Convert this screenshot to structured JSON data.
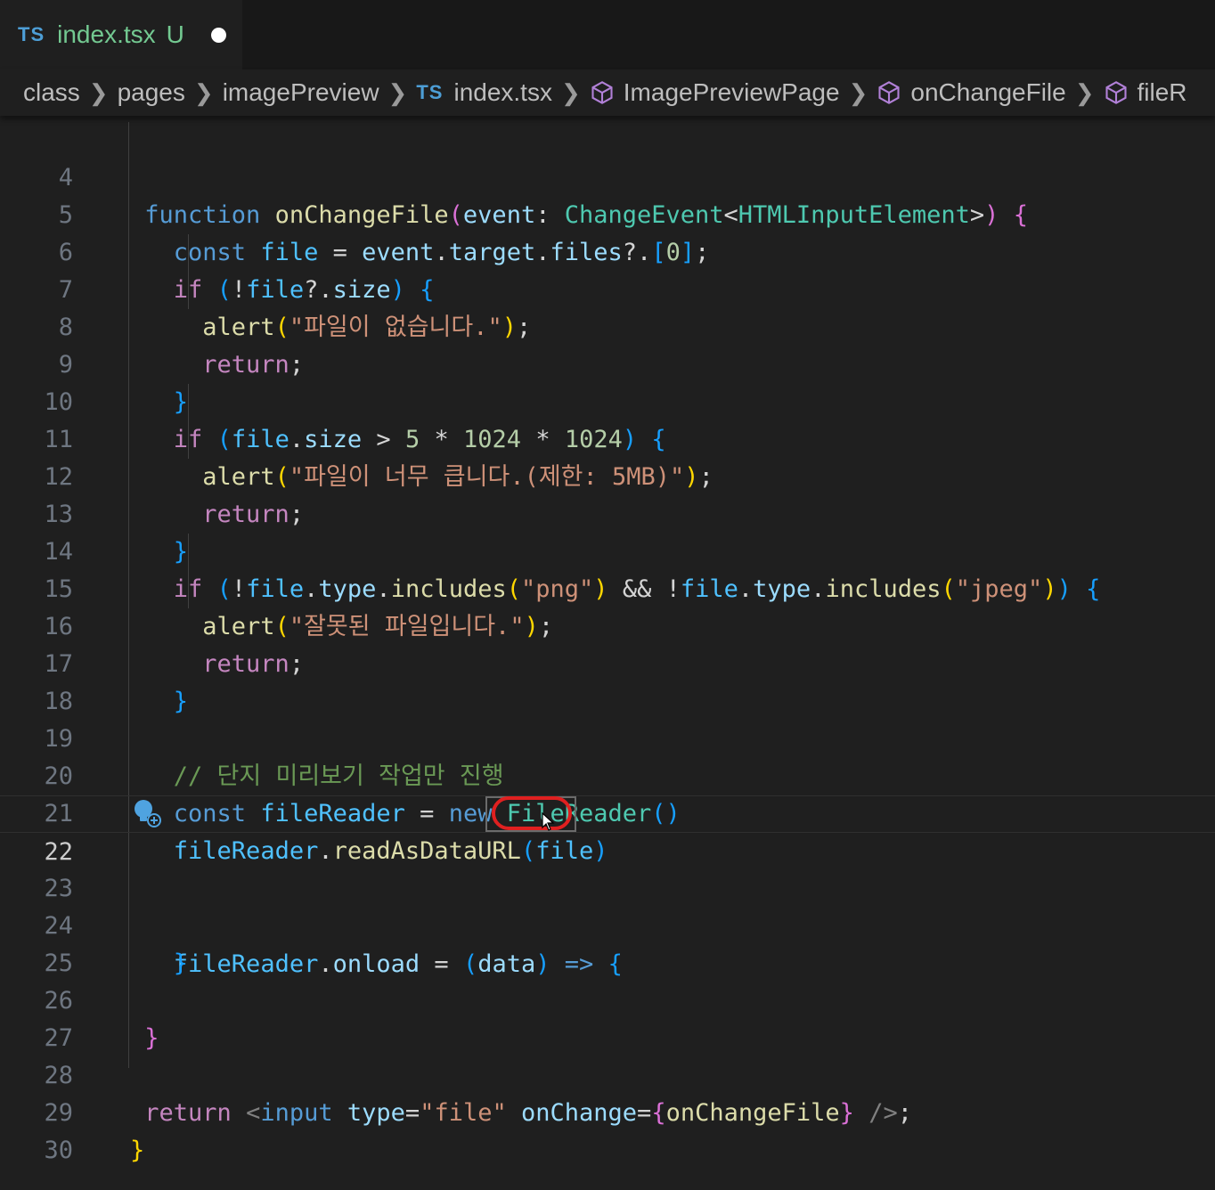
{
  "tab": {
    "lang": "TS",
    "filename": "index.tsx",
    "status": "U"
  },
  "breadcrumb": {
    "items": [
      "class",
      "pages",
      "imagePreview",
      "index.tsx",
      "ImagePreviewPage",
      "onChangeFile",
      "fileR"
    ],
    "ts_badge": "TS"
  },
  "editor": {
    "current_line": "22",
    "lines": [
      {
        "n": "4"
      },
      {
        "n": "5"
      },
      {
        "n": "6"
      },
      {
        "n": "7"
      },
      {
        "n": "8"
      },
      {
        "n": "9"
      },
      {
        "n": "10"
      },
      {
        "n": "11"
      },
      {
        "n": "12"
      },
      {
        "n": "13"
      },
      {
        "n": "14"
      },
      {
        "n": "15"
      },
      {
        "n": "16"
      },
      {
        "n": "17"
      },
      {
        "n": "18"
      },
      {
        "n": "19"
      },
      {
        "n": "20"
      },
      {
        "n": "21"
      },
      {
        "n": "22"
      },
      {
        "n": "23"
      },
      {
        "n": "24"
      },
      {
        "n": "25"
      },
      {
        "n": "26"
      },
      {
        "n": "27"
      },
      {
        "n": "28"
      },
      {
        "n": "29"
      },
      {
        "n": "30"
      }
    ],
    "tokens": {
      "function": "function",
      "onChangeFile": "onChangeFile",
      "event": "event",
      "ChangeEvent": "ChangeEvent",
      "HTMLInputElement": "HTMLInputElement",
      "const": "const",
      "file": "file",
      "target": "target",
      "files": "files",
      "zero": "0",
      "if": "if",
      "size": "size",
      "alert": "alert",
      "return": "return",
      "five": "5",
      "k1024": "1024",
      "type": "type",
      "includes": "includes",
      "png": "\"png\"",
      "jpeg": "\"jpeg\"",
      "fileReader": "fileReader",
      "new": "new",
      "FileReader": "FileReader",
      "readAsDataURL": "readAsDataURL",
      "onload": "onload",
      "data": "data",
      "input": "input",
      "type_attr": "type",
      "file_str": "\"file\"",
      "onChange": "onChange"
    },
    "strings": {
      "no_file": "\"파일이 없습니다.\"",
      "too_big": "\"파일이 너무 큽니다.(제한: 5MB)\"",
      "wrong_file": "\"잘못된 파일입니다.\""
    },
    "comment": "// 단지 미리보기 작업만 진행"
  },
  "colors": {
    "background": "#1f1f1f",
    "annotation": "#e02020",
    "keyword": "#569cd6",
    "control": "#c586c0",
    "function": "#dcdcaa",
    "variable": "#9cdcfe",
    "type": "#4ec9b0",
    "string": "#ce9178",
    "comment": "#6a9955"
  },
  "icons": [
    "cube-icon",
    "lightbulb-icon",
    "mouse-pointer-icon"
  ]
}
